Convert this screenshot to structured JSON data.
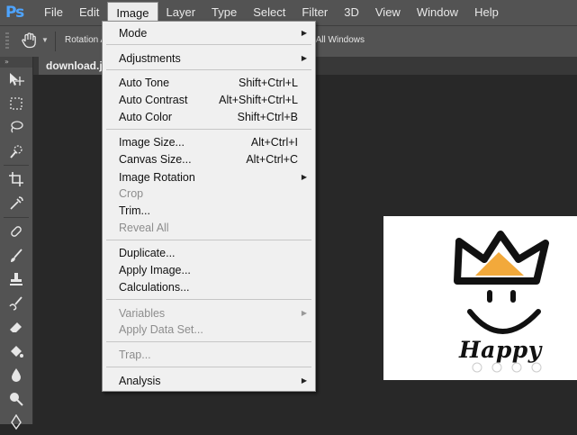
{
  "app": {
    "logo": "Ps"
  },
  "menubar": {
    "items": [
      {
        "label": "File"
      },
      {
        "label": "Edit"
      },
      {
        "label": "Image"
      },
      {
        "label": "Layer"
      },
      {
        "label": "Type"
      },
      {
        "label": "Select"
      },
      {
        "label": "Filter"
      },
      {
        "label": "3D"
      },
      {
        "label": "View"
      },
      {
        "label": "Window"
      },
      {
        "label": "Help"
      }
    ]
  },
  "options_bar": {
    "rotation_label": "Rotation A",
    "windows_label": "te All Windows"
  },
  "document": {
    "tab_label": "download.jp"
  },
  "canvas": {
    "image_text": "Happy",
    "accent_color": "#f2a93b"
  },
  "image_menu": {
    "items": [
      {
        "label": "Mode",
        "shortcut": "",
        "submenu": true,
        "enabled": true
      },
      {
        "label": "Adjustments",
        "shortcut": "",
        "submenu": true,
        "enabled": true
      },
      {
        "label": "Auto Tone",
        "shortcut": "Shift+Ctrl+L",
        "submenu": false,
        "enabled": true
      },
      {
        "label": "Auto Contrast",
        "shortcut": "Alt+Shift+Ctrl+L",
        "submenu": false,
        "enabled": true
      },
      {
        "label": "Auto Color",
        "shortcut": "Shift+Ctrl+B",
        "submenu": false,
        "enabled": true
      },
      {
        "label": "Image Size...",
        "shortcut": "Alt+Ctrl+I",
        "submenu": false,
        "enabled": true
      },
      {
        "label": "Canvas Size...",
        "shortcut": "Alt+Ctrl+C",
        "submenu": false,
        "enabled": true
      },
      {
        "label": "Image Rotation",
        "shortcut": "",
        "submenu": true,
        "enabled": true
      },
      {
        "label": "Crop",
        "shortcut": "",
        "submenu": false,
        "enabled": false
      },
      {
        "label": "Trim...",
        "shortcut": "",
        "submenu": false,
        "enabled": true
      },
      {
        "label": "Reveal All",
        "shortcut": "",
        "submenu": false,
        "enabled": false
      },
      {
        "label": "Duplicate...",
        "shortcut": "",
        "submenu": false,
        "enabled": true
      },
      {
        "label": "Apply Image...",
        "shortcut": "",
        "submenu": false,
        "enabled": true
      },
      {
        "label": "Calculations...",
        "shortcut": "",
        "submenu": false,
        "enabled": true
      },
      {
        "label": "Variables",
        "shortcut": "",
        "submenu": true,
        "enabled": false
      },
      {
        "label": "Apply Data Set...",
        "shortcut": "",
        "submenu": false,
        "enabled": false
      },
      {
        "label": "Trap...",
        "shortcut": "",
        "submenu": false,
        "enabled": false
      },
      {
        "label": "Analysis",
        "shortcut": "",
        "submenu": true,
        "enabled": true
      }
    ]
  },
  "tools": [
    "move-tool-icon",
    "marquee-tool-icon",
    "lasso-tool-icon",
    "quick-selection-tool-icon",
    "crop-tool-icon",
    "eyedropper-tool-icon",
    "healing-brush-tool-icon",
    "brush-tool-icon",
    "clone-stamp-tool-icon",
    "history-brush-tool-icon",
    "eraser-tool-icon",
    "paint-bucket-tool-icon",
    "blur-tool-icon",
    "dodge-tool-icon",
    "pen-tool-icon"
  ]
}
